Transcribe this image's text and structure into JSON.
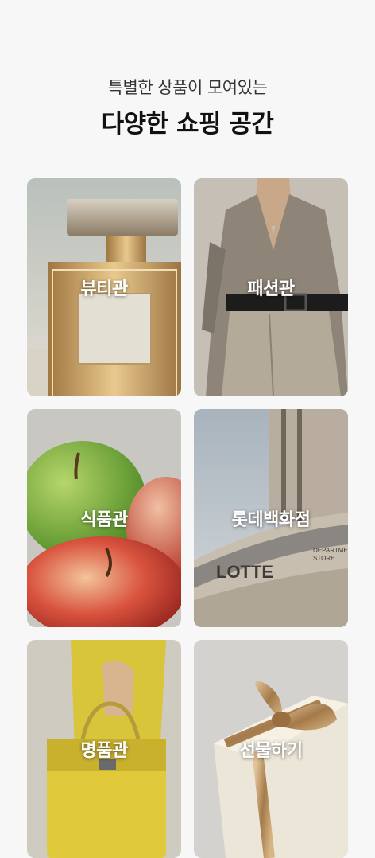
{
  "header": {
    "subtitle": "특별한 상품이 모여있는",
    "title": "다양한 쇼핑 공간"
  },
  "categories": [
    {
      "label": "뷰티관",
      "image": "perfume-bottle"
    },
    {
      "label": "패션관",
      "image": "fashion-model-dress"
    },
    {
      "label": "식품관",
      "image": "apples"
    },
    {
      "label": "롯데백화점",
      "image": "lotte-department-store-building",
      "image_text": "LOTTE DEPARTMENT STORE"
    },
    {
      "label": "명품관",
      "image": "yellow-handbag"
    },
    {
      "label": "선물하기",
      "image": "gift-box-ribbon"
    }
  ]
}
